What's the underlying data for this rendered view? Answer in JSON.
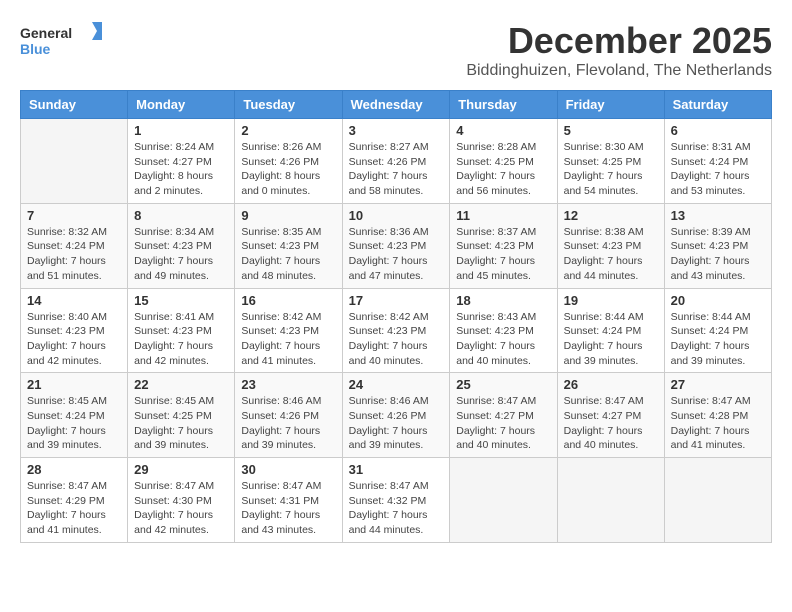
{
  "header": {
    "logo_general": "General",
    "logo_blue": "Blue",
    "month_title": "December 2025",
    "location": "Biddinghuizen, Flevoland, The Netherlands"
  },
  "days_of_week": [
    "Sunday",
    "Monday",
    "Tuesday",
    "Wednesday",
    "Thursday",
    "Friday",
    "Saturday"
  ],
  "weeks": [
    [
      {
        "day": "",
        "info": ""
      },
      {
        "day": "1",
        "info": "Sunrise: 8:24 AM\nSunset: 4:27 PM\nDaylight: 8 hours\nand 2 minutes."
      },
      {
        "day": "2",
        "info": "Sunrise: 8:26 AM\nSunset: 4:26 PM\nDaylight: 8 hours\nand 0 minutes."
      },
      {
        "day": "3",
        "info": "Sunrise: 8:27 AM\nSunset: 4:26 PM\nDaylight: 7 hours\nand 58 minutes."
      },
      {
        "day": "4",
        "info": "Sunrise: 8:28 AM\nSunset: 4:25 PM\nDaylight: 7 hours\nand 56 minutes."
      },
      {
        "day": "5",
        "info": "Sunrise: 8:30 AM\nSunset: 4:25 PM\nDaylight: 7 hours\nand 54 minutes."
      },
      {
        "day": "6",
        "info": "Sunrise: 8:31 AM\nSunset: 4:24 PM\nDaylight: 7 hours\nand 53 minutes."
      }
    ],
    [
      {
        "day": "7",
        "info": "Sunrise: 8:32 AM\nSunset: 4:24 PM\nDaylight: 7 hours\nand 51 minutes."
      },
      {
        "day": "8",
        "info": "Sunrise: 8:34 AM\nSunset: 4:23 PM\nDaylight: 7 hours\nand 49 minutes."
      },
      {
        "day": "9",
        "info": "Sunrise: 8:35 AM\nSunset: 4:23 PM\nDaylight: 7 hours\nand 48 minutes."
      },
      {
        "day": "10",
        "info": "Sunrise: 8:36 AM\nSunset: 4:23 PM\nDaylight: 7 hours\nand 47 minutes."
      },
      {
        "day": "11",
        "info": "Sunrise: 8:37 AM\nSunset: 4:23 PM\nDaylight: 7 hours\nand 45 minutes."
      },
      {
        "day": "12",
        "info": "Sunrise: 8:38 AM\nSunset: 4:23 PM\nDaylight: 7 hours\nand 44 minutes."
      },
      {
        "day": "13",
        "info": "Sunrise: 8:39 AM\nSunset: 4:23 PM\nDaylight: 7 hours\nand 43 minutes."
      }
    ],
    [
      {
        "day": "14",
        "info": "Sunrise: 8:40 AM\nSunset: 4:23 PM\nDaylight: 7 hours\nand 42 minutes."
      },
      {
        "day": "15",
        "info": "Sunrise: 8:41 AM\nSunset: 4:23 PM\nDaylight: 7 hours\nand 42 minutes."
      },
      {
        "day": "16",
        "info": "Sunrise: 8:42 AM\nSunset: 4:23 PM\nDaylight: 7 hours\nand 41 minutes."
      },
      {
        "day": "17",
        "info": "Sunrise: 8:42 AM\nSunset: 4:23 PM\nDaylight: 7 hours\nand 40 minutes."
      },
      {
        "day": "18",
        "info": "Sunrise: 8:43 AM\nSunset: 4:23 PM\nDaylight: 7 hours\nand 40 minutes."
      },
      {
        "day": "19",
        "info": "Sunrise: 8:44 AM\nSunset: 4:24 PM\nDaylight: 7 hours\nand 39 minutes."
      },
      {
        "day": "20",
        "info": "Sunrise: 8:44 AM\nSunset: 4:24 PM\nDaylight: 7 hours\nand 39 minutes."
      }
    ],
    [
      {
        "day": "21",
        "info": "Sunrise: 8:45 AM\nSunset: 4:24 PM\nDaylight: 7 hours\nand 39 minutes."
      },
      {
        "day": "22",
        "info": "Sunrise: 8:45 AM\nSunset: 4:25 PM\nDaylight: 7 hours\nand 39 minutes."
      },
      {
        "day": "23",
        "info": "Sunrise: 8:46 AM\nSunset: 4:26 PM\nDaylight: 7 hours\nand 39 minutes."
      },
      {
        "day": "24",
        "info": "Sunrise: 8:46 AM\nSunset: 4:26 PM\nDaylight: 7 hours\nand 39 minutes."
      },
      {
        "day": "25",
        "info": "Sunrise: 8:47 AM\nSunset: 4:27 PM\nDaylight: 7 hours\nand 40 minutes."
      },
      {
        "day": "26",
        "info": "Sunrise: 8:47 AM\nSunset: 4:27 PM\nDaylight: 7 hours\nand 40 minutes."
      },
      {
        "day": "27",
        "info": "Sunrise: 8:47 AM\nSunset: 4:28 PM\nDaylight: 7 hours\nand 41 minutes."
      }
    ],
    [
      {
        "day": "28",
        "info": "Sunrise: 8:47 AM\nSunset: 4:29 PM\nDaylight: 7 hours\nand 41 minutes."
      },
      {
        "day": "29",
        "info": "Sunrise: 8:47 AM\nSunset: 4:30 PM\nDaylight: 7 hours\nand 42 minutes."
      },
      {
        "day": "30",
        "info": "Sunrise: 8:47 AM\nSunset: 4:31 PM\nDaylight: 7 hours\nand 43 minutes."
      },
      {
        "day": "31",
        "info": "Sunrise: 8:47 AM\nSunset: 4:32 PM\nDaylight: 7 hours\nand 44 minutes."
      },
      {
        "day": "",
        "info": ""
      },
      {
        "day": "",
        "info": ""
      },
      {
        "day": "",
        "info": ""
      }
    ]
  ],
  "accent_color": "#4a90d9"
}
